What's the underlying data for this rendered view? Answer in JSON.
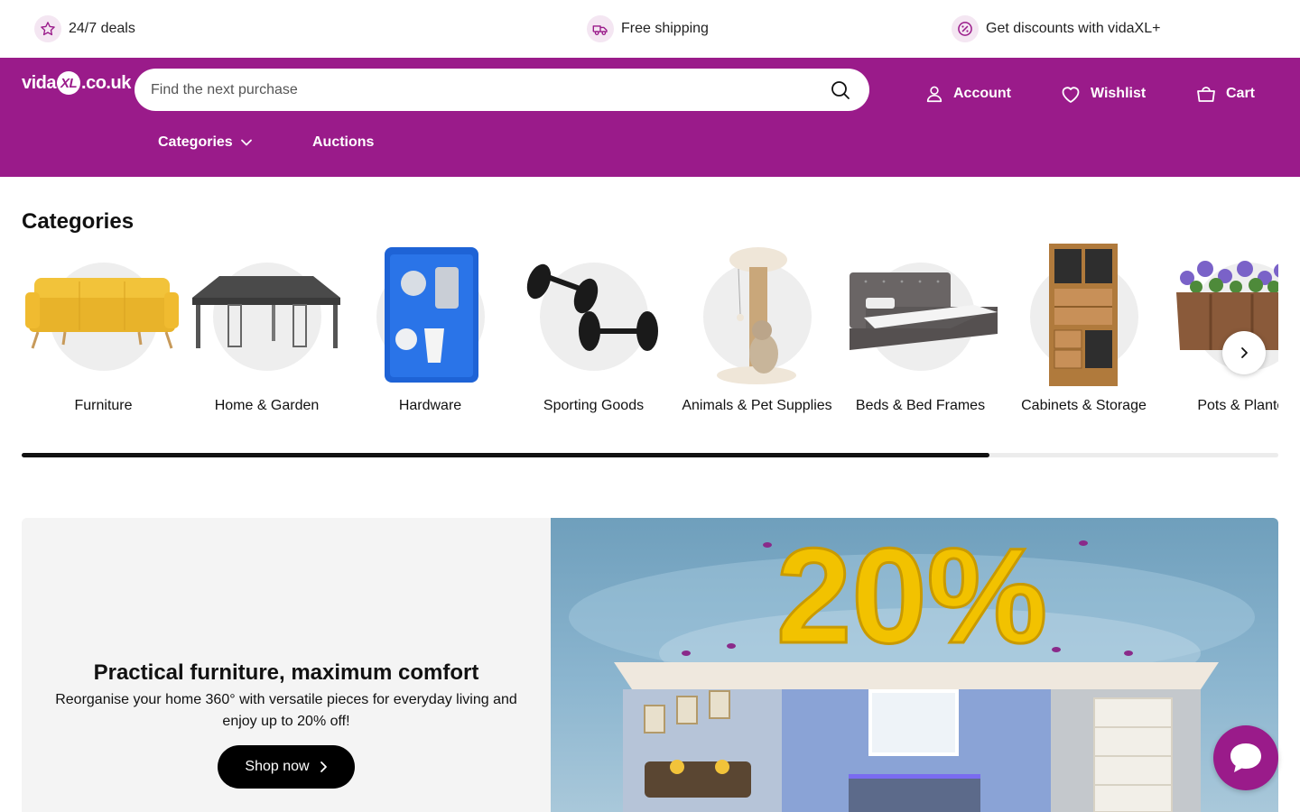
{
  "usp": {
    "deals": "24/7 deals",
    "shipping": "Free shipping",
    "discounts": "Get discounts with vidaXL+"
  },
  "header": {
    "logo_left": "vida",
    "logo_xl": "XL",
    "logo_right": ".co.uk",
    "search_placeholder": "Find the next purchase",
    "account": "Account",
    "wishlist": "Wishlist",
    "cart": "Cart",
    "nav": {
      "categories": "Categories",
      "auctions": "Auctions"
    }
  },
  "categories": {
    "title": "Categories",
    "items": [
      {
        "label": "Furniture",
        "icon": "sofa-image"
      },
      {
        "label": "Home & Garden",
        "icon": "gazebo-image"
      },
      {
        "label": "Hardware",
        "icon": "spray-gun-kit-image"
      },
      {
        "label": "Sporting Goods",
        "icon": "dumbbells-image"
      },
      {
        "label": "Animals & Pet Supplies",
        "icon": "cat-tree-image"
      },
      {
        "label": "Beds & Bed Frames",
        "icon": "bed-image"
      },
      {
        "label": "Cabinets & Storage",
        "icon": "cabinet-image"
      },
      {
        "label": "Pots & Planters",
        "icon": "planter-image"
      }
    ],
    "scroll_progress": 0.77
  },
  "promo": {
    "heading": "Practical furniture, maximum comfort",
    "text": "Reorganise your home 360° with versatile pieces for everyday living and enjoy up to 20% off!",
    "button": "Shop now",
    "banner_text": "20%"
  },
  "colors": {
    "brand": "#9a1b8a",
    "promo_bg": "#f4f4f4",
    "banner_yellow": "#f2c200"
  }
}
